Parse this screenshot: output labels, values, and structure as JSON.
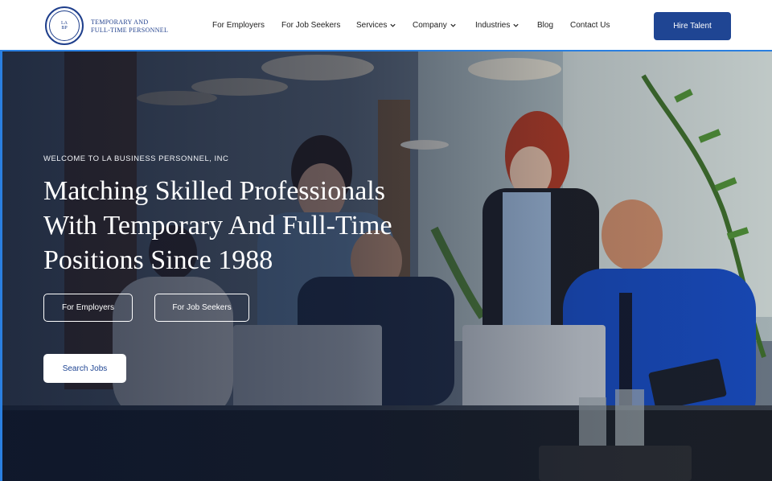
{
  "logo": {
    "text": "LA BUSINESS PERSONNEL"
  },
  "brand": {
    "line1": "TEMPORARY AND",
    "line2": "FULL-TIME PERSONNEL"
  },
  "nav": {
    "items": [
      {
        "label": "For Employers",
        "dropdown": false
      },
      {
        "label": "For Job Seekers",
        "dropdown": false
      },
      {
        "label": "Services",
        "dropdown": true
      },
      {
        "label": "Company",
        "dropdown": true
      },
      {
        "label": "Industries",
        "dropdown": true
      },
      {
        "label": "Blog",
        "dropdown": false
      },
      {
        "label": "Contact Us",
        "dropdown": false
      }
    ],
    "cta": "Hire Talent"
  },
  "hero": {
    "eyebrow": "WELCOME TO LA BUSINESS PERSONNEL, INC",
    "headline_line1": "Matching Skilled Professionals",
    "headline_line2": "With Temporary And Full-Time",
    "headline_line3": "Positions Since 1988",
    "btn_employers": "For Employers",
    "btn_jobseekers": "For Job Seekers",
    "btn_search": "Search Jobs"
  },
  "colors": {
    "brand_blue": "#1f4593",
    "accent_line": "#2a7fe0",
    "logo_blue": "#1f3f8c"
  }
}
